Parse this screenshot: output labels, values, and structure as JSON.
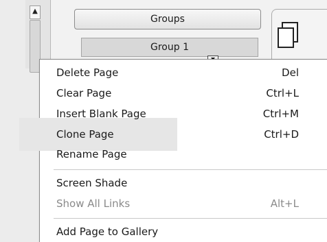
{
  "background": {
    "groups_button_label": "Groups",
    "group_selector_value": "Group 1"
  },
  "context_menu": {
    "items": [
      {
        "label": "Delete Page",
        "shortcut": "Del",
        "enabled": true
      },
      {
        "label": "Clear Page",
        "shortcut": "Ctrl+L",
        "enabled": true
      },
      {
        "label": "Insert Blank Page",
        "shortcut": "Ctrl+M",
        "enabled": true
      },
      {
        "label": "Clone Page",
        "shortcut": "Ctrl+D",
        "enabled": true,
        "hovered": true
      },
      {
        "label": "Rename Page",
        "shortcut": "",
        "enabled": true
      },
      {
        "label": "Screen Shade",
        "shortcut": "",
        "enabled": true
      },
      {
        "label": "Show All Links",
        "shortcut": "Alt+L",
        "enabled": false
      },
      {
        "label": "Add Page to Gallery",
        "shortcut": "",
        "enabled": true
      }
    ]
  },
  "colors": {
    "menu_background": "#ffffff",
    "highlight": "#e6e6e6",
    "disabled_text": "#8a8a8a"
  }
}
